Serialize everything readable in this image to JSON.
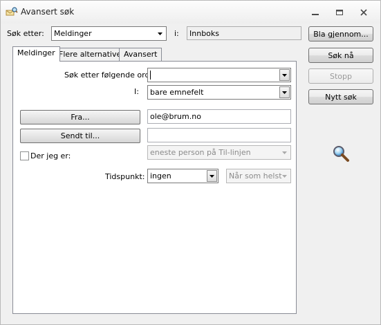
{
  "window": {
    "title": "Avansert søk",
    "controls": {
      "minimize": "minimize",
      "maximize": "maximize",
      "close": "close"
    }
  },
  "search_for": {
    "label": "Søk etter:",
    "value": "Meldinger",
    "in_label": "i:",
    "location": "Innboks"
  },
  "actions": {
    "browse": "Bla gjennom...",
    "search_now": "Søk nå",
    "stop": "Stopp",
    "new_search": "Nytt søk"
  },
  "tabs": [
    {
      "label": "Meldinger",
      "active": true
    },
    {
      "label": "Flere alternativer",
      "active": false
    },
    {
      "label": "Avansert",
      "active": false
    }
  ],
  "messages_tab": {
    "words_label": "Søk etter følgende ord:",
    "words_value": "",
    "in_label": "I:",
    "in_value": "bare emnefelt",
    "from_button": "Fra...",
    "from_value": "ole@brum.no",
    "sent_to_button": "Sendt til...",
    "sent_to_value": "",
    "where_label": "Der jeg er:",
    "where_checked": false,
    "where_value": "eneste person på Til-linjen",
    "time_label": "Tidspunkt:",
    "time_value": "ingen",
    "time_range_value": "Når som helst"
  },
  "icons": {
    "app": "search-envelope-icon",
    "search": "magnifier-icon"
  }
}
